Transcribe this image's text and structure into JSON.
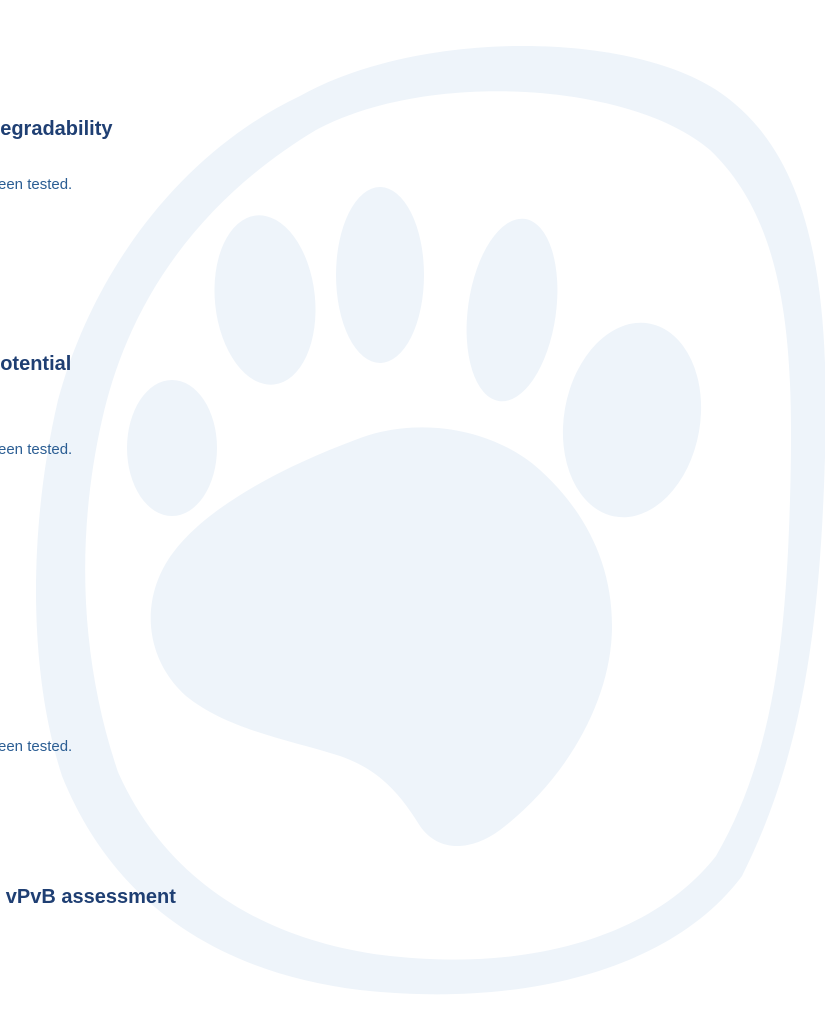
{
  "sections": [
    {
      "heading": "degradability",
      "body": "een tested."
    },
    {
      "heading": "potential",
      "body": "een tested."
    },
    {
      "heading": "",
      "body": "een tested."
    },
    {
      "heading": "d vPvB assessment",
      "body": ""
    }
  ],
  "watermark_icon": "paw-print-icon",
  "colors": {
    "heading": "#1f3f73",
    "body": "#2a5d93",
    "watermark": "#eef4fa"
  }
}
